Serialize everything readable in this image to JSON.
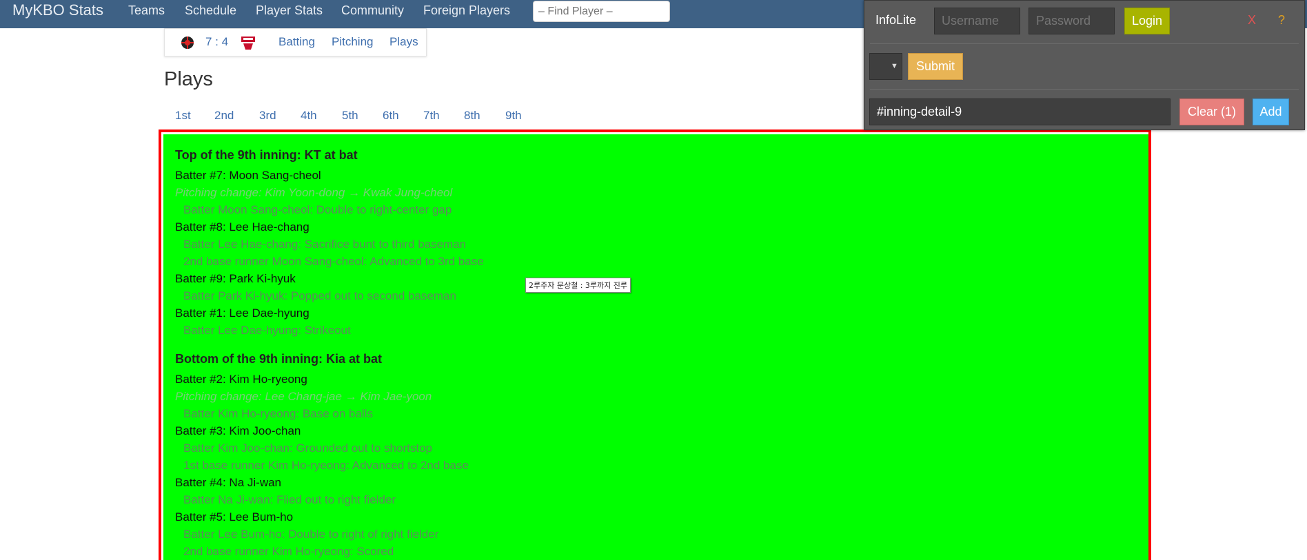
{
  "navbar": {
    "brand": "MyKBO Stats",
    "items": [
      "Teams",
      "Schedule",
      "Player Stats",
      "Community",
      "Foreign Players"
    ],
    "search_placeholder": "– Find Player –"
  },
  "scorebox": {
    "score": "7 : 4",
    "links": [
      "Batting",
      "Pitching",
      "Plays"
    ]
  },
  "page_title": "Plays",
  "innings": [
    "1st",
    "2nd",
    "3rd",
    "4th",
    "5th",
    "6th",
    "7th",
    "8th",
    "9th"
  ],
  "detail": {
    "top": {
      "heading": "Top of the 9th inning: KT at bat",
      "lines": [
        {
          "kind": "batter",
          "text": "Batter #7: Moon Sang-cheol"
        },
        {
          "kind": "pitch",
          "text": "Pitching change: Kim Yoon-dong → Kwak Jung-cheol"
        },
        {
          "kind": "event",
          "text": "Batter Moon Sang-cheol: Double to right-center gap"
        },
        {
          "kind": "batter",
          "text": "Batter #8: Lee Hae-chang"
        },
        {
          "kind": "event",
          "text": "Batter Lee Hae-chang: Sacrifice bunt to third baseman"
        },
        {
          "kind": "event",
          "text": "2nd base runner Moon Sang-cheol: Advanced to 3rd base"
        },
        {
          "kind": "batter",
          "text": "Batter #9: Park Ki-hyuk"
        },
        {
          "kind": "event",
          "text": "Batter Park Ki-hyuk: Popped out to second baseman"
        },
        {
          "kind": "batter",
          "text": "Batter #1: Lee Dae-hyung"
        },
        {
          "kind": "event",
          "text": "Batter Lee Dae-hyung: Strikeout"
        }
      ]
    },
    "bottom": {
      "heading": "Bottom of the 9th inning: Kia at bat",
      "lines": [
        {
          "kind": "batter",
          "text": "Batter #2: Kim Ho-ryeong"
        },
        {
          "kind": "pitch",
          "text": "Pitching change: Lee Chang-jae → Kim Jae-yoon"
        },
        {
          "kind": "event",
          "text": "Batter Kim Ho-ryeong: Base on balls"
        },
        {
          "kind": "batter",
          "text": "Batter #3: Kim Joo-chan"
        },
        {
          "kind": "event",
          "text": "Batter Kim Joo-chan: Grounded out to shortstop"
        },
        {
          "kind": "event",
          "text": "1st base runner Kim Ho-ryeong: Advanced to 2nd base"
        },
        {
          "kind": "batter",
          "text": "Batter #4: Na Ji-wan"
        },
        {
          "kind": "event",
          "text": "Batter Na Ji-wan: Flied out to right fielder"
        },
        {
          "kind": "batter",
          "text": "Batter #5: Lee Bum-ho"
        },
        {
          "kind": "event",
          "text": "Batter Lee Bum-ho: Double to right of right fielder"
        },
        {
          "kind": "event",
          "text": "2nd base runner Kim Ho-ryeong: Scored"
        }
      ]
    }
  },
  "tooltip": "2루주자 문상철 : 3루까지 진루",
  "infolite": {
    "title": "InfoLite",
    "username_placeholder": "Username",
    "password_placeholder": "Password",
    "login_label": "Login",
    "close_label": "X",
    "help_label": "?",
    "select_arrow": "▼",
    "submit_label": "Submit",
    "selector_value": "#inning-detail-9",
    "clear_label": "Clear (1)",
    "add_label": "Add"
  },
  "colors": {
    "navbar": "#3e6185",
    "highlight_fill": "#00ff00",
    "highlight_border": "#ff0000",
    "link": "#3f6fae"
  }
}
